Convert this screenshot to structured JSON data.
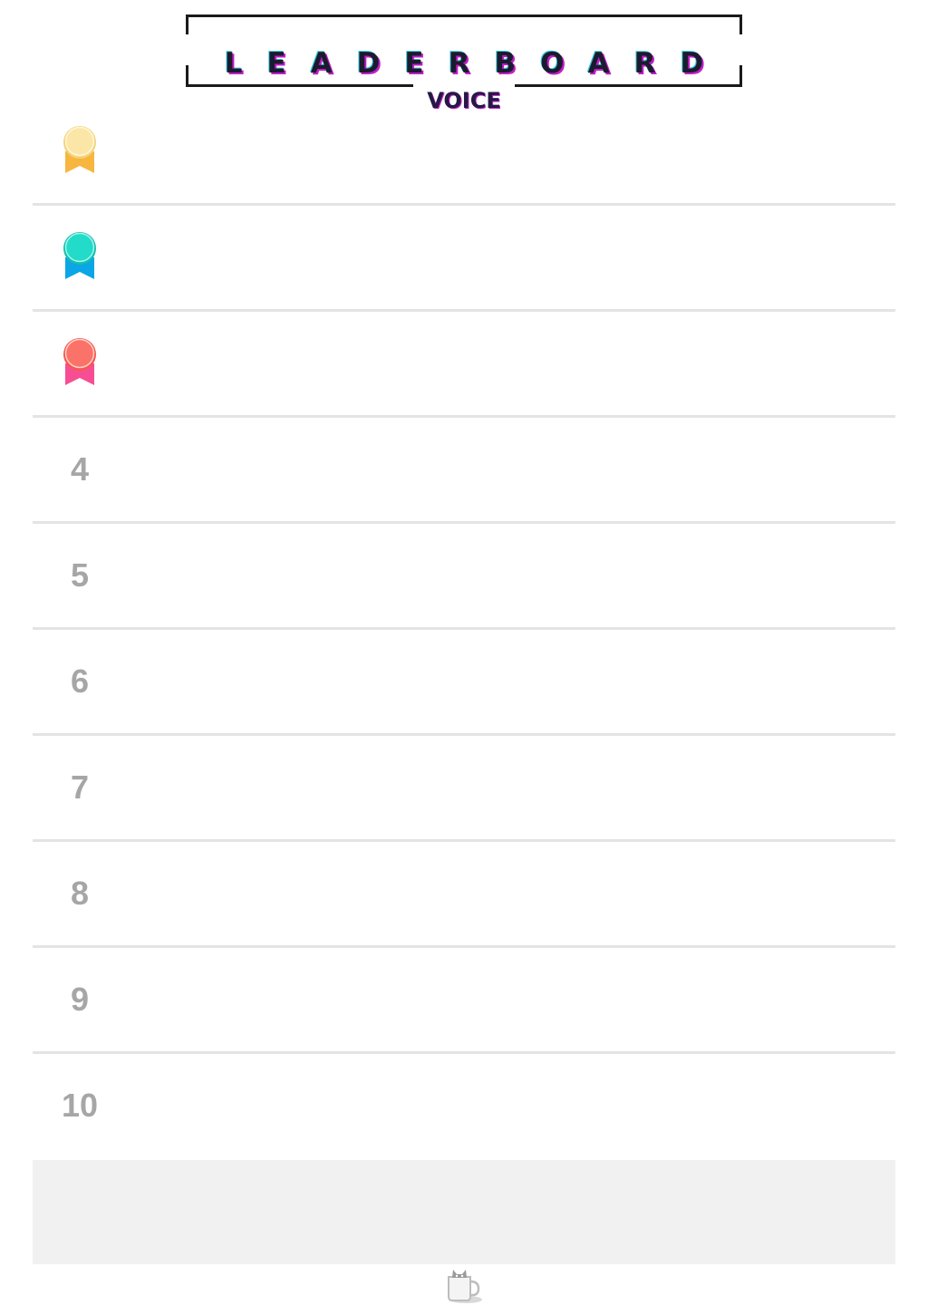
{
  "header": {
    "title": "LEADERBOARD",
    "subtitle": "VOICE"
  },
  "leaderboard": {
    "rows": [
      {
        "rank": "1",
        "medal": "gold-medal-icon",
        "name": ""
      },
      {
        "rank": "2",
        "medal": "teal-medal-icon",
        "name": ""
      },
      {
        "rank": "3",
        "medal": "red-medal-icon",
        "name": ""
      },
      {
        "rank": "4",
        "name": ""
      },
      {
        "rank": "5",
        "name": ""
      },
      {
        "rank": "6",
        "name": ""
      },
      {
        "rank": "7",
        "name": ""
      },
      {
        "rank": "8",
        "name": ""
      },
      {
        "rank": "9",
        "name": ""
      },
      {
        "rank": "10",
        "name": ""
      }
    ]
  },
  "colors": {
    "gold_disc": "#fbe3a0",
    "gold_ribbon": "#f7b640",
    "teal_disc": "#1fd6c6",
    "teal_ribbon": "#0aa6e6",
    "red_disc": "#fb6f6a",
    "red_ribbon": "#f74e93",
    "rank_text": "#a6a6a6",
    "divider": "#e4e4e4",
    "footer_panel": "#f1f1f1"
  },
  "footer": {
    "icon": "coffee-mug-cat-icon"
  }
}
